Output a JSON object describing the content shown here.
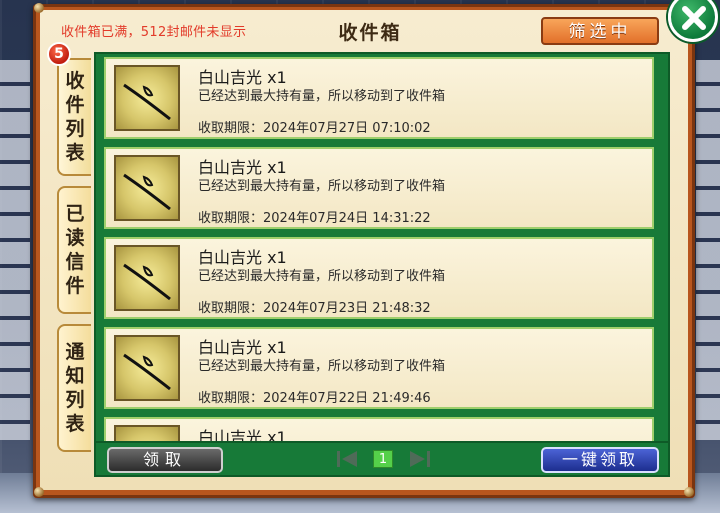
{
  "header": {
    "warning": "收件箱已满，512封邮件未显示",
    "title": "收件箱",
    "filter_label": "筛选中",
    "close_icon": "close-icon"
  },
  "tabs": [
    {
      "label": "收件列表",
      "active": true
    },
    {
      "label": "已读信件",
      "active": false
    },
    {
      "label": "通知列表",
      "active": false
    }
  ],
  "badge": {
    "count": "5"
  },
  "mails": [
    {
      "name": "白山吉光 x1",
      "desc": "已经达到最大持有量，所以移动到了收件箱",
      "date": "收取期限：2024年07月27日 07:10:02"
    },
    {
      "name": "白山吉光 x1",
      "desc": "已经达到最大持有量，所以移动到了收件箱",
      "date": "收取期限：2024年07月24日 14:31:22"
    },
    {
      "name": "白山吉光 x1",
      "desc": "已经达到最大持有量，所以移动到了收件箱",
      "date": "收取期限：2024年07月23日 21:48:32"
    },
    {
      "name": "白山吉光 x1",
      "desc": "已经达到最大持有量，所以移动到了收件箱",
      "date": "收取期限：2024年07月22日 21:49:46"
    },
    {
      "name": "白山吉光 x1",
      "desc": "",
      "date": ""
    }
  ],
  "footer": {
    "claim_label": "领取",
    "claim_all_label": "一键领取",
    "page": "1"
  },
  "colors": {
    "frame": "#b8561e",
    "list_bg": "#177a38",
    "warning": "#e23b2a",
    "filter_btn": "#e2702a",
    "claim_all_btn": "#1d2e8f"
  }
}
